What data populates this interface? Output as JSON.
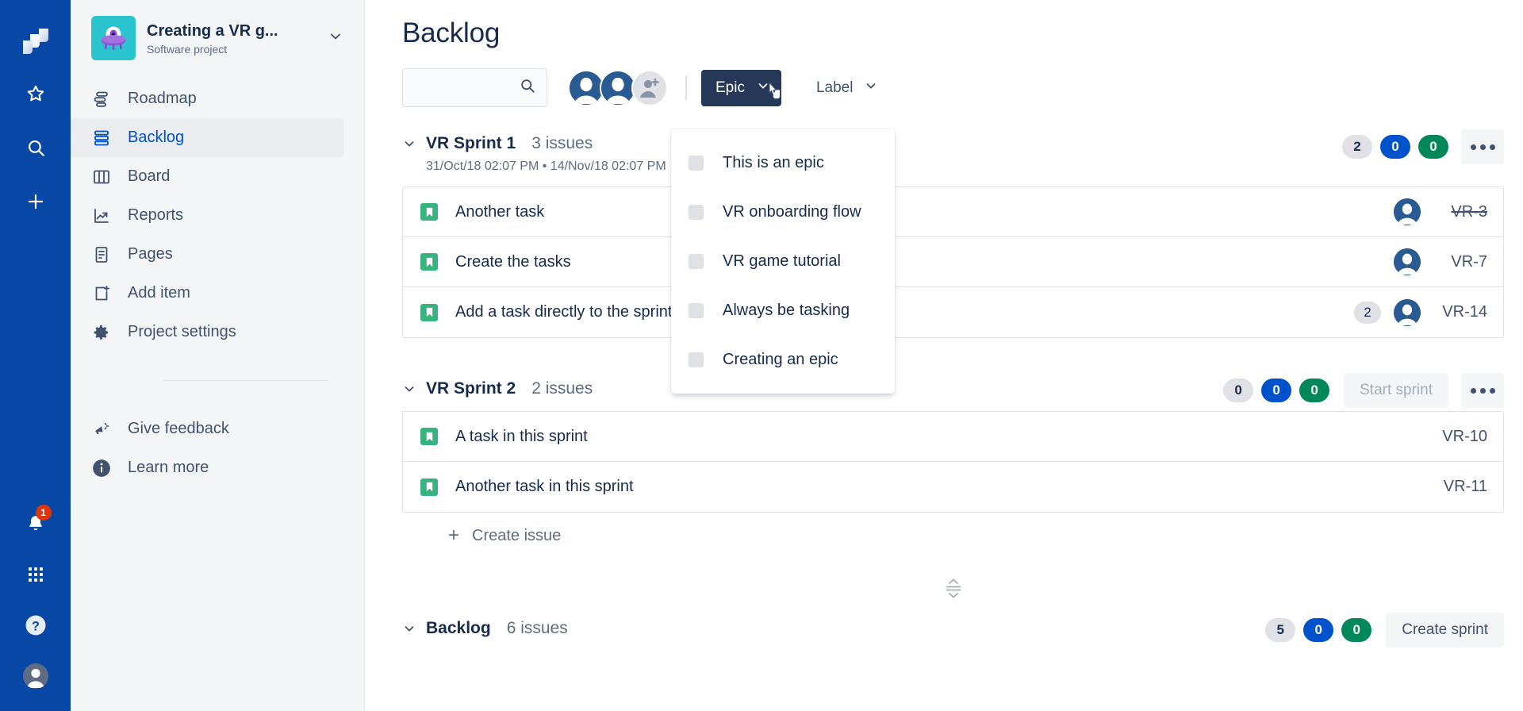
{
  "rail": {
    "logo_icon": "jira-logo-icon",
    "items": [
      {
        "name": "starred-icon",
        "label": "Starred"
      },
      {
        "name": "search-icon",
        "label": "Search"
      },
      {
        "name": "create-icon",
        "label": "Create"
      }
    ],
    "bottom": [
      {
        "name": "notifications-icon",
        "label": "Notifications",
        "badge": "1"
      },
      {
        "name": "app-switcher-icon",
        "label": "App switcher",
        "badge": ""
      },
      {
        "name": "help-icon",
        "label": "Help",
        "badge": ""
      },
      {
        "name": "profile-avatar",
        "label": "Your profile",
        "badge": ""
      }
    ]
  },
  "sidebar": {
    "project": {
      "name": "Creating a VR g...",
      "type": "Software project",
      "avatar_icon": "ufo-project-avatar",
      "chevron_icon": "chevron-down-icon"
    },
    "items": [
      {
        "label": "Roadmap",
        "icon": "roadmap-icon",
        "active": false
      },
      {
        "label": "Backlog",
        "icon": "backlog-icon",
        "active": true
      },
      {
        "label": "Board",
        "icon": "board-icon",
        "active": false
      },
      {
        "label": "Reports",
        "icon": "reports-icon",
        "active": false
      },
      {
        "label": "Pages",
        "icon": "pages-icon",
        "active": false
      },
      {
        "label": "Add item",
        "icon": "add-item-icon",
        "active": false
      },
      {
        "label": "Project settings",
        "icon": "project-settings-icon",
        "active": false
      }
    ],
    "footer": [
      {
        "label": "Give feedback",
        "icon": "megaphone-icon"
      },
      {
        "label": "Learn more",
        "icon": "info-icon"
      }
    ]
  },
  "header": {
    "title": "Backlog"
  },
  "toolbar": {
    "search": {
      "value": "",
      "placeholder": "",
      "icon": "search-icon"
    },
    "avatars": [
      {
        "name": "avatar-user-1"
      },
      {
        "name": "avatar-user-2"
      },
      {
        "name": "avatar-add-user"
      }
    ],
    "epic_filter": {
      "label": "Epic",
      "icon": "chevron-down-icon",
      "open": true
    },
    "label_filter": {
      "label": "Label",
      "icon": "chevron-down-icon",
      "open": false
    }
  },
  "epic_dropdown": {
    "options": [
      {
        "label": "This is an epic",
        "checked": false
      },
      {
        "label": "VR onboarding flow",
        "checked": false
      },
      {
        "label": "VR game tutorial",
        "checked": false
      },
      {
        "label": "Always be tasking",
        "checked": false
      },
      {
        "label": "Creating an epic",
        "checked": false
      }
    ]
  },
  "sections": [
    {
      "name": "VR Sprint 1",
      "count": "3 issues",
      "dates": "31/Oct/18 02:07 PM • 14/Nov/18 02:07 PM",
      "pills": {
        "grey": "2",
        "blue": "0",
        "green": "0"
      },
      "action": null,
      "more": "...",
      "issues": [
        {
          "title": "Another task",
          "type": "story",
          "estimate": "",
          "assignee": true,
          "key": "VR-3",
          "done": true
        },
        {
          "title": "Create the tasks",
          "type": "story",
          "estimate": "",
          "assignee": true,
          "key": "VR-7",
          "done": false
        },
        {
          "title": "Add a task directly to the sprint",
          "type": "story",
          "estimate": "2",
          "assignee": true,
          "key": "VR-14",
          "done": false
        }
      ],
      "create_issue": null
    },
    {
      "name": "VR Sprint 2",
      "count": "2 issues",
      "dates": "",
      "pills": {
        "grey": "0",
        "blue": "0",
        "green": "0"
      },
      "action": {
        "label": "Start sprint",
        "disabled": true
      },
      "more": "...",
      "issues": [
        {
          "title": "A task in this sprint",
          "type": "story",
          "estimate": "",
          "assignee": false,
          "key": "VR-10",
          "done": false
        },
        {
          "title": "Another task in this sprint",
          "type": "story",
          "estimate": "",
          "assignee": false,
          "key": "VR-11",
          "done": false
        }
      ],
      "create_issue": {
        "label": "Create issue",
        "icon": "plus-icon"
      }
    },
    {
      "name": "Backlog",
      "count": "6 issues",
      "dates": "",
      "pills": {
        "grey": "5",
        "blue": "0",
        "green": "0"
      },
      "action": {
        "label": "Create sprint",
        "disabled": false
      },
      "more": "",
      "issues": [],
      "create_issue": null
    }
  ],
  "resizer": {
    "name": "panel-resize-handle"
  }
}
